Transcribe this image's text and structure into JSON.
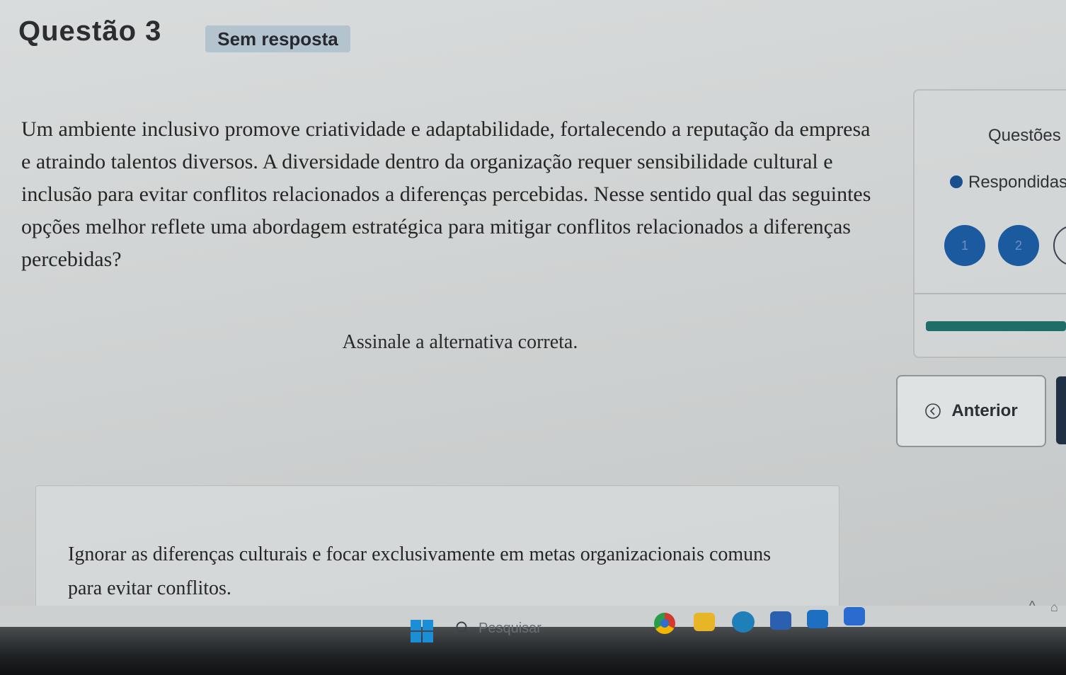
{
  "header": {
    "title": "Questão 3",
    "status_badge": "Sem resposta"
  },
  "question": {
    "text": "Um ambiente inclusivo promove criatividade e adaptabilidade, fortalecendo a reputação da empresa e atraindo talentos diversos.  A diversidade dentro da organização requer sensibilidade cultural e inclusão para evitar conflitos relacionados a diferenças percebidas. Nesse sentido qual das seguintes opções melhor reflete uma abordagem estratégica para mitigar conflitos relacionados a diferenças percebidas?",
    "instruction": "Assinale a alternativa correta."
  },
  "options": [
    {
      "text": "Ignorar as diferenças culturais e focar exclusivamente em metas organizacionais comuns para evitar conflitos."
    }
  ],
  "side_panel": {
    "title": "Questões r",
    "legend_label": "Respondidas",
    "question_numbers": [
      "1",
      "2"
    ],
    "colors": {
      "answered": "#1c5aa0",
      "progress": "#1e6d68"
    }
  },
  "navigation": {
    "previous_label": "Anterior"
  },
  "taskbar": {
    "search_placeholder": "Pesquisar",
    "apps": [
      "chrome-icon",
      "file-explorer-icon",
      "edge-icon",
      "store-icon",
      "outlook-icon",
      "word-icon"
    ]
  }
}
